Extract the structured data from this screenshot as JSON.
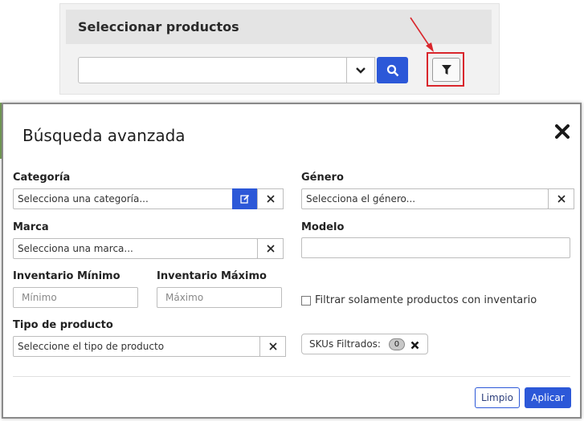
{
  "background": {
    "title": "Seleccionar productos",
    "search_value": "",
    "icons": {
      "dropdown": "chevron-down-icon",
      "search": "search-icon",
      "filter": "filter-icon"
    },
    "colors": {
      "accent": "#2c58d8",
      "highlight": "#d9262c"
    }
  },
  "modal": {
    "title": "Búsqueda avanzada",
    "categoria": {
      "label": "Categoría",
      "placeholder": "Selecciona una categoría..."
    },
    "genero": {
      "label": "Género",
      "placeholder": "Selecciona el género..."
    },
    "marca": {
      "label": "Marca",
      "placeholder": "Selecciona una marca..."
    },
    "modelo": {
      "label": "Modelo",
      "value": ""
    },
    "inventario_minimo": {
      "label": "Inventario Mínimo",
      "placeholder": "Mínimo"
    },
    "inventario_maximo": {
      "label": "Inventario Máximo",
      "placeholder": "Máximo"
    },
    "filtrar_inventario": {
      "label": "Filtrar solamente productos con inventario",
      "checked": false
    },
    "tipo_producto": {
      "label": "Tipo de producto",
      "placeholder": "Seleccione el tipo de producto"
    },
    "skus": {
      "label": "SKUs Filtrados:",
      "count": "0"
    },
    "buttons": {
      "limpio": "Limpio",
      "aplicar": "Aplicar"
    }
  }
}
